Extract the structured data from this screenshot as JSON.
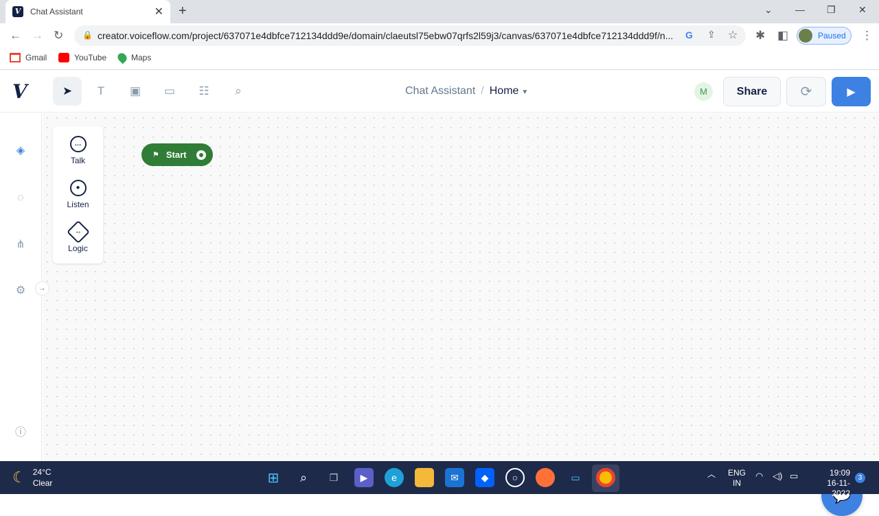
{
  "browser": {
    "tab_title": "Chat Assistant",
    "url": "creator.voiceflow.com/project/637071e4dbfce712134ddd9e/domain/claeutsl75ebw07qrfs2l59j3/canvas/637071e4dbfce712134ddd9f/n...",
    "profile_label": "Paused",
    "bookmarks": [
      {
        "label": "Gmail",
        "icon": "gmail-icon"
      },
      {
        "label": "YouTube",
        "icon": "youtube-icon"
      },
      {
        "label": "Maps",
        "icon": "maps-icon"
      }
    ]
  },
  "app": {
    "logo": "V",
    "breadcrumb": {
      "project": "Chat Assistant",
      "separator": "/",
      "page": "Home"
    },
    "user_initial": "M",
    "share_label": "Share",
    "accent": "#3d82e2",
    "start_color": "#2f7d36"
  },
  "step_menu": [
    {
      "label": "Talk",
      "icon": "talk-icon"
    },
    {
      "label": "Listen",
      "icon": "listen-icon"
    },
    {
      "label": "Logic",
      "icon": "logic-icon"
    }
  ],
  "canvas": {
    "start_label": "Start"
  },
  "taskbar": {
    "temperature": "24°C",
    "condition": "Clear",
    "lang_line1": "ENG",
    "lang_line2": "IN",
    "time": "19:09",
    "date": "16-11-2022",
    "notification_count": "3"
  }
}
